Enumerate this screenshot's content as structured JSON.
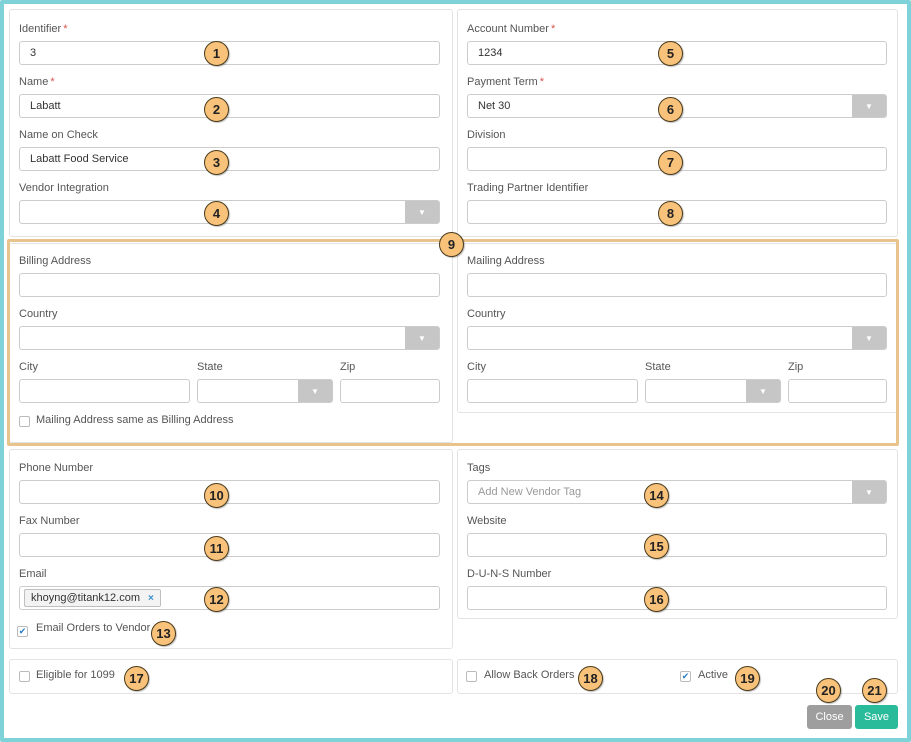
{
  "vendor": {
    "identifier": {
      "label": "Identifier",
      "value": "3"
    },
    "name": {
      "label": "Name",
      "value": "Labatt"
    },
    "name_on_check": {
      "label": "Name on Check",
      "value": "Labatt Food Service"
    },
    "vendor_integration": {
      "label": "Vendor Integration",
      "value": ""
    },
    "account_number": {
      "label": "Account Number",
      "value": "1234"
    },
    "payment_term": {
      "label": "Payment Term",
      "value": "Net 30"
    },
    "division": {
      "label": "Division",
      "value": ""
    },
    "trading_partner": {
      "label": "Trading Partner Identifier",
      "value": ""
    },
    "required_mark": "*"
  },
  "billing": {
    "address_label": "Billing Address",
    "country_label": "Country",
    "city_label": "City",
    "state_label": "State",
    "zip_label": "Zip",
    "same_as_billing_label": "Mailing Address same as Billing Address"
  },
  "mailing": {
    "address_label": "Mailing Address",
    "country_label": "Country",
    "city_label": "City",
    "state_label": "State",
    "zip_label": "Zip"
  },
  "contact": {
    "phone_label": "Phone Number",
    "fax_label": "Fax Number",
    "email_label": "Email",
    "email_tag": "khoyng@titank12.com",
    "email_orders_label": "Email Orders to Vendor",
    "tags_label": "Tags",
    "tags_placeholder": "Add New Vendor Tag",
    "website_label": "Website",
    "duns_label": "D-U-N-S Number"
  },
  "flags": {
    "eligible_1099_label": "Eligible for 1099",
    "allow_back_orders_label": "Allow Back Orders",
    "active_label": "Active"
  },
  "actions": {
    "close_label": "Close",
    "save_label": "Save"
  },
  "badges": [
    "1",
    "2",
    "3",
    "4",
    "5",
    "6",
    "7",
    "8",
    "9",
    "10",
    "11",
    "12",
    "13",
    "14",
    "15",
    "16",
    "17",
    "18",
    "19",
    "20",
    "21"
  ],
  "icons": {
    "caret": "▼",
    "check": "✔",
    "remove": "×"
  },
  "colors": {
    "frame": "#7fd3d8",
    "highlight": "#e8c48c",
    "badge": "#f8c27a",
    "save": "#2abb9b",
    "close": "#9e9e9e",
    "required": "#d9534f"
  }
}
